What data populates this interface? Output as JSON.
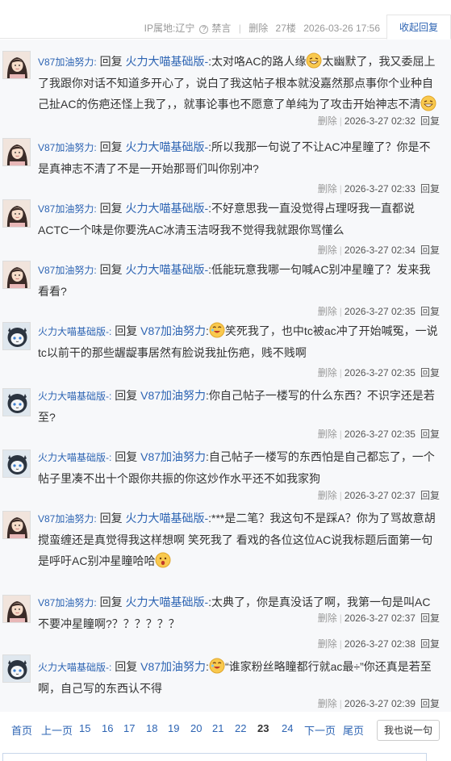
{
  "topbar": {
    "ip": "IP属地:辽宁",
    "mute": "禁言",
    "delete": "删除",
    "floor": "27楼",
    "datetime": "2026-03-26 17:56",
    "collapse": "收起回复"
  },
  "footer": {
    "delete": "删除",
    "reply": "回复"
  },
  "colors": {
    "link": "#2d64b3",
    "bg": "#f7f8fa"
  },
  "replies": [
    {
      "user": "V87加油努力:",
      "reply_word": "回复",
      "target": "火力大喵基础版-",
      "text_pre": ":太对咯AC的路人缘",
      "text_mid": "太幽默了，我又委屈上了我跟你对话不知道多开心了，说白了我这帖子根本就没嘉然那点事你个业种自己扯AC的伤疤还怪上我了，，就事论事也不愿意了单纯为了攻击开始神志不清",
      "time": "2026-3-27 02:32"
    },
    {
      "user": "V87加油努力:",
      "reply_word": "回复",
      "target": "火力大喵基础版-",
      "text": ":所以我那一句说了不让AC冲星瞳了？你是不是真神志不清了不是一开始那哥们叫你别冲?",
      "time": "2026-3-27 02:33"
    },
    {
      "user": "V87加油努力:",
      "reply_word": "回复",
      "target": "火力大喵基础版-",
      "text": ":不好意思我一直没觉得占理呀我一直都说ACTC一个味是你要洗AC冰清玉洁呀我不觉得我就跟你骂懂么",
      "time": "2026-3-27 02:34"
    },
    {
      "user": "V87加油努力:",
      "reply_word": "回复",
      "target": "火力大喵基础版-",
      "text": ":低能玩意我哪一句喊AC别冲星瞳了？发来我看看?",
      "time": "2026-3-27 02:35"
    },
    {
      "user": "火力大喵基础版-:",
      "reply_word": "回复",
      "target": "V87加油努力",
      "text_pre": ":",
      "text_mid": "笑死我了，也中tc被ac冲了开始喊冤，一说tc以前干的那些龌龊事居然有脸说我扯伤疤，贱不贱啊",
      "time": "2026-3-27 02:35"
    },
    {
      "user": "火力大喵基础版-:",
      "reply_word": "回复",
      "target": "V87加油努力",
      "text": ":你自己帖子一楼写的什么东西？不识字还是若至?",
      "time": "2026-3-27 02:35"
    },
    {
      "user": "火力大喵基础版-:",
      "reply_word": "回复",
      "target": "V87加油努力",
      "text": ":自己帖子一楼写的东西怕是自己都忘了，一个帖子里凑不出十个跟你共振的你这炒作水平还不如我家狗",
      "time": "2026-3-27 02:37"
    },
    {
      "user": "V87加油努力:",
      "reply_word": "回复",
      "target": "火力大喵基础版-",
      "text_pre": ":***是二笔？我这句不是踩A？你为了骂故意胡搅蛮缠还是真觉得我这样想啊 笑死我了 看戏的各位这位AC说我标题后面第一句是呼吁AC别冲星瞳哈哈",
      "time": "2026-3-27 02:37"
    },
    {
      "user": "V87加油努力:",
      "reply_word": "回复",
      "target": "火力大喵基础版-",
      "text": ":太典了，你是真没话了啊，我第一句是叫AC不要冲星瞳啊?？？？？？？",
      "time": "2026-3-27 02:38"
    },
    {
      "user": "火力大喵基础版-:",
      "reply_word": "回复",
      "target": "V87加油努力",
      "text_pre": ":",
      "text_mid": "“谁家粉丝略瞳都行就ac最÷”你还真是若至啊，自己写的东西认不得",
      "time": "2026-3-27 02:39"
    }
  ],
  "pager": {
    "first": "首页",
    "prev": "上一页",
    "pages": [
      "15",
      "16",
      "17",
      "18",
      "19",
      "20",
      "21",
      "22",
      "23",
      "24"
    ],
    "current": "23",
    "next": "下一页",
    "last": "尾页",
    "say": "我也说一句"
  }
}
